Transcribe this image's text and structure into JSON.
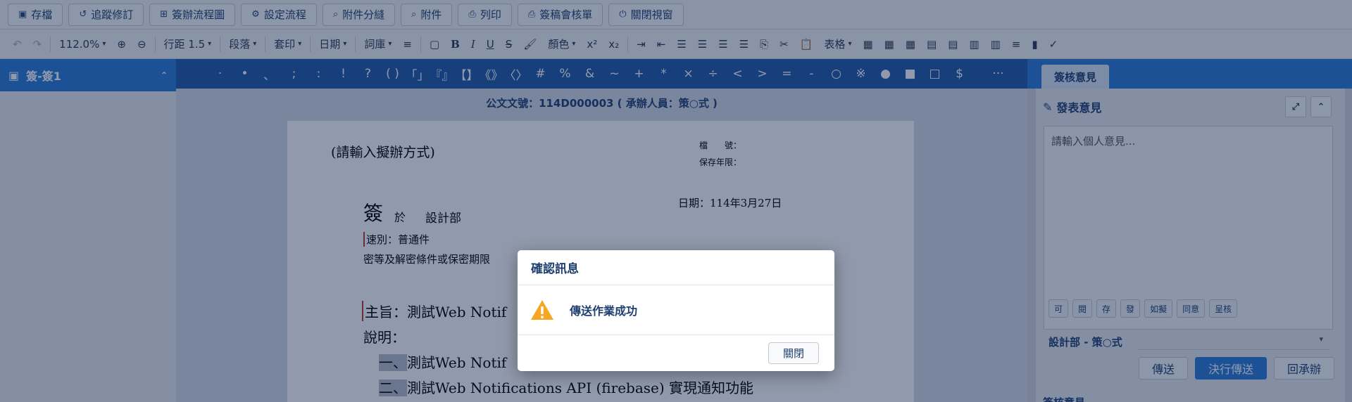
{
  "toolbar": {
    "buttons": [
      {
        "icon": "save-icon",
        "glyph": "▣",
        "label": "存檔"
      },
      {
        "icon": "history-icon",
        "glyph": "↺",
        "label": "追蹤修訂"
      },
      {
        "icon": "flowchart-icon",
        "glyph": "⊞",
        "label": "簽辦流程圖"
      },
      {
        "icon": "cogs-icon",
        "glyph": "⚙",
        "label": "設定流程"
      },
      {
        "icon": "paperclip-icon",
        "glyph": "⌕",
        "label": "附件分縫"
      },
      {
        "icon": "paperclip-icon",
        "glyph": "⌕",
        "label": "附件"
      },
      {
        "icon": "print-icon",
        "glyph": "⎙",
        "label": "列印"
      },
      {
        "icon": "print-icon",
        "glyph": "⎙",
        "label": "簽稿會核單"
      },
      {
        "icon": "power-icon",
        "glyph": "⏻",
        "label": "關閉視窗"
      }
    ]
  },
  "format_bar": {
    "undo": "↶",
    "redo": "↷",
    "zoom": "112.0%",
    "zoom_in": "⊕",
    "zoom_out": "⊖",
    "line_spacing": "行距 1.5",
    "paragraph": "段落",
    "stamp": "套印",
    "date": "日期",
    "lexicon": "詞庫",
    "list": "≡",
    "bold": "B",
    "italic": "I",
    "underline": "U",
    "strike": "S",
    "color": "顏色",
    "superscript": "x²",
    "subscript": "x₂",
    "table": "表格"
  },
  "sidebar": {
    "header_label": "簽-簽1",
    "chevron": "⌃"
  },
  "symbols": [
    "·",
    "•",
    "、",
    ";",
    ":",
    "!",
    "?",
    "( )",
    "「」",
    "『』",
    "【】",
    "《》",
    "〈〉",
    "#",
    "%",
    "&",
    "~",
    "+",
    "*",
    "×",
    "÷",
    "<",
    ">",
    "=",
    "-",
    "○",
    "※",
    "●",
    "■",
    "□",
    "$"
  ],
  "document": {
    "title": "公文文號：114D000003 ( 承辦人員：策○式 )",
    "method": "(請輸入擬辦方式)",
    "file_no_label": "檔　　號：",
    "retention_label": "保存年限：",
    "date": "日期：114年3月27日",
    "sign_big": "簽",
    "sign_at": "於",
    "dept": "設計部",
    "speed": "速別：普通件",
    "secret": "密等及解密條件或保密期限",
    "subject": "主旨：測試Web Notif",
    "explain": "說明：",
    "item1_no": "一、",
    "item1": "測試Web Notif",
    "item2_no": "二、",
    "item2": "測試Web Notifications API (firebase) 實現通知功能"
  },
  "right_panel": {
    "tab": "簽核意見",
    "opinion_title": "發表意見",
    "placeholder": "請輸入個人意見...",
    "quick": [
      "可",
      "閱",
      "存",
      "發",
      "如擬",
      "同意",
      "呈核"
    ],
    "dept_label": "設計部 - 策○式",
    "select_caret": "▾",
    "actions": [
      "傳送",
      "決行傳送",
      "回承辦"
    ],
    "sub_title": "簽核意見"
  },
  "dialog": {
    "title": "確認訊息",
    "message": "傳送作業成功",
    "close": "關閉"
  }
}
